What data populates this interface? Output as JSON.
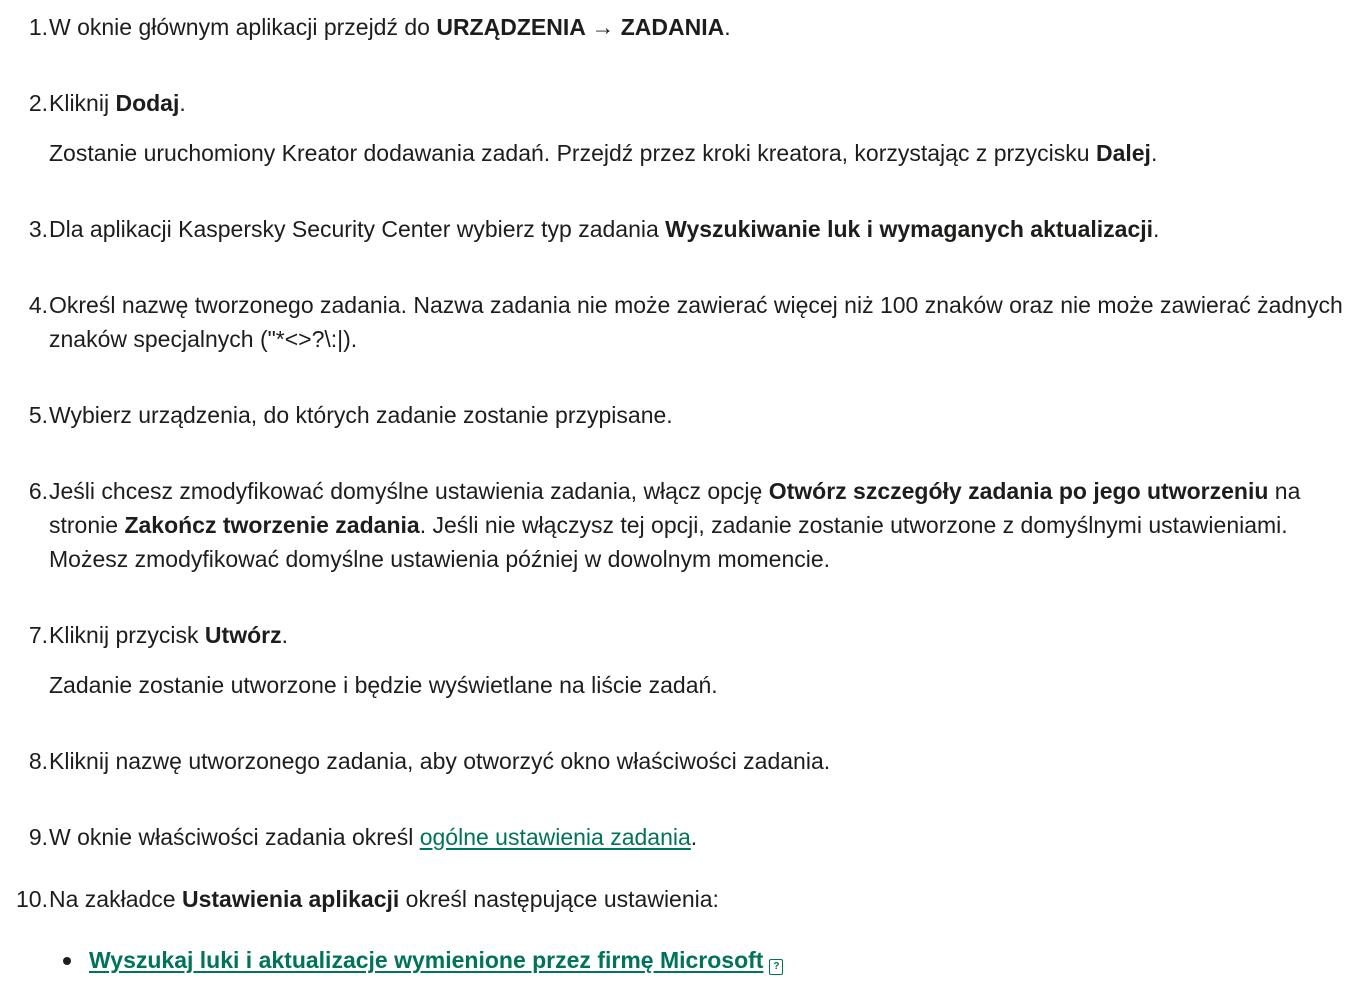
{
  "steps": [
    {
      "num": "1.",
      "pre": "W oknie głównym aplikacji przejdź do ",
      "bold": "URZĄDZENIA → ZADANIA",
      "post": "."
    },
    {
      "num": "2.",
      "pre": "Kliknij ",
      "bold": "Dodaj",
      "post": ".",
      "sub_pre": "Zostanie uruchomiony Kreator dodawania zadań. Przejdź przez kroki kreatora, korzystając z przycisku ",
      "sub_bold": "Dalej",
      "sub_post": "."
    },
    {
      "num": "3.",
      "pre": "Dla aplikacji Kaspersky Security Center wybierz typ zadania ",
      "bold": "Wyszukiwanie luk i wymaganych aktualizacji",
      "post": "."
    },
    {
      "num": "4.",
      "text": "Określ nazwę tworzonego zadania. Nazwa zadania nie może zawierać więcej niż 100 znaków oraz nie może zawierać żadnych znaków specjalnych (\"*<>?\\:|)."
    },
    {
      "num": "5.",
      "text": "Wybierz urządzenia, do których zadanie zostanie przypisane."
    },
    {
      "num": "6.",
      "pre": "Jeśli chcesz zmodyfikować domyślne ustawienia zadania, włącz opcję ",
      "bold": "Otwórz szczegóły zadania po jego utworzeniu",
      "mid": " na stronie ",
      "bold2": "Zakończ tworzenie zadania",
      "post": ". Jeśli nie włączysz tej opcji, zadanie zostanie utworzone z domyślnymi ustawieniami. Możesz zmodyfikować domyślne ustawienia później w dowolnym momencie."
    },
    {
      "num": "7.",
      "pre": "Kliknij przycisk ",
      "bold": "Utwórz",
      "post": ".",
      "sub_text": "Zadanie zostanie utworzone i będzie wyświetlane na liście zadań."
    },
    {
      "num": "8.",
      "text": "Kliknij nazwę utworzonego zadania, aby otworzyć okno właściwości zadania."
    },
    {
      "num": "9.",
      "pre": "W oknie właściwości zadania określ ",
      "link": "ogólne ustawienia zadania",
      "post": "."
    },
    {
      "num": "10.",
      "pre": "Na zakładce ",
      "bold": "Ustawienia aplikacji",
      "post": " określ następujące ustawienia:"
    }
  ],
  "bullets": [
    {
      "label": "Wyszukaj luki i aktualizacje wymienione przez firmę Microsoft",
      "icon": "help-icon",
      "icon_glyph": "?"
    }
  ],
  "colors": {
    "text": "#1d1d1b",
    "link": "#00735a"
  }
}
